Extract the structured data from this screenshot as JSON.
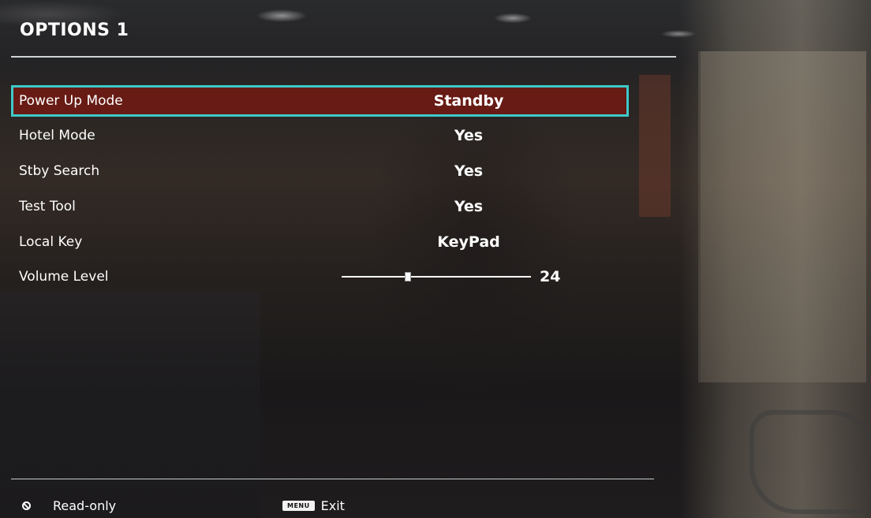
{
  "header": {
    "title": "OPTIONS 1"
  },
  "menu": {
    "items": [
      {
        "label": "Power Up Mode",
        "value": "Standby",
        "selected": true
      },
      {
        "label": "Hotel Mode",
        "value": "Yes"
      },
      {
        "label": "Stby Search",
        "value": "Yes"
      },
      {
        "label": "Test Tool",
        "value": "Yes"
      },
      {
        "label": "Local Key",
        "value": "KeyPad"
      },
      {
        "label": "Volume Level",
        "value": "24",
        "type": "slider",
        "level": 24,
        "max": 100
      }
    ]
  },
  "footer": {
    "readonly_icon": "no-entry-icon",
    "readonly_label": "Read-only",
    "menu_key": "MENU",
    "exit_label": "Exit"
  },
  "colors": {
    "selection_border": "#3ec9c9",
    "selection_fill": "#701a12",
    "text": "#ffffff"
  }
}
